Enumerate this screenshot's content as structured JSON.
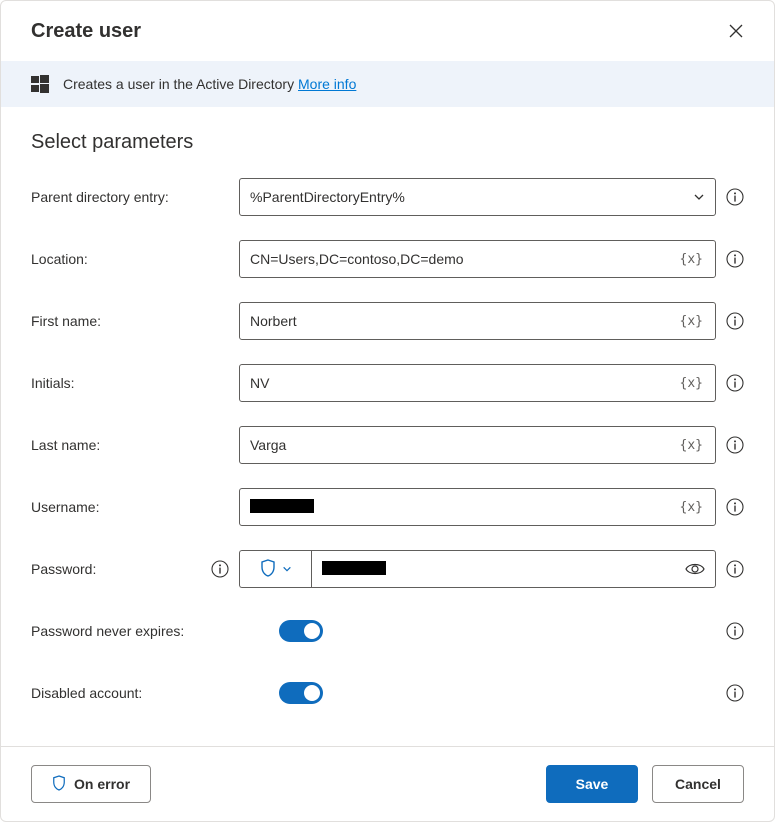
{
  "header": {
    "title": "Create user"
  },
  "banner": {
    "text": "Creates a user in the Active Directory",
    "link": "More info"
  },
  "section_title": "Select parameters",
  "fields": {
    "parent_dir": {
      "label": "Parent directory entry:",
      "value": "%ParentDirectoryEntry%"
    },
    "location": {
      "label": "Location:",
      "value": "CN=Users,DC=contoso,DC=demo"
    },
    "first_name": {
      "label": "First name:",
      "value": "Norbert"
    },
    "initials": {
      "label": "Initials:",
      "value": "NV"
    },
    "last_name": {
      "label": "Last name:",
      "value": "Varga"
    },
    "username": {
      "label": "Username:"
    },
    "password": {
      "label": "Password:"
    },
    "pw_never_expires": {
      "label": "Password never expires:",
      "on": true
    },
    "disabled_account": {
      "label": "Disabled account:",
      "on": true
    }
  },
  "variable_badge": "{x}",
  "footer": {
    "on_error": "On error",
    "save": "Save",
    "cancel": "Cancel"
  },
  "colors": {
    "accent": "#0f6cbd",
    "banner_bg": "#eef3fa"
  }
}
